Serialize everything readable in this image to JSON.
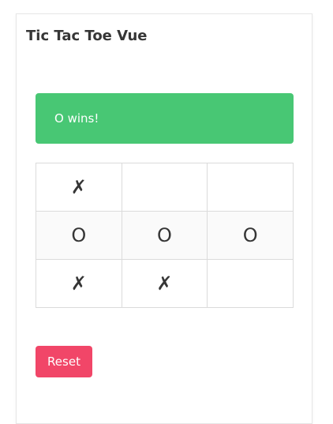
{
  "app": {
    "title": "Tic Tac Toe Vue"
  },
  "status": {
    "message": "O wins!",
    "color": "#48c774"
  },
  "board": {
    "cells": [
      [
        "✗",
        "",
        ""
      ],
      [
        "O",
        "O",
        "O"
      ],
      [
        "✗",
        "✗",
        ""
      ]
    ]
  },
  "controls": {
    "reset_label": "Reset",
    "reset_color": "#f14668"
  }
}
